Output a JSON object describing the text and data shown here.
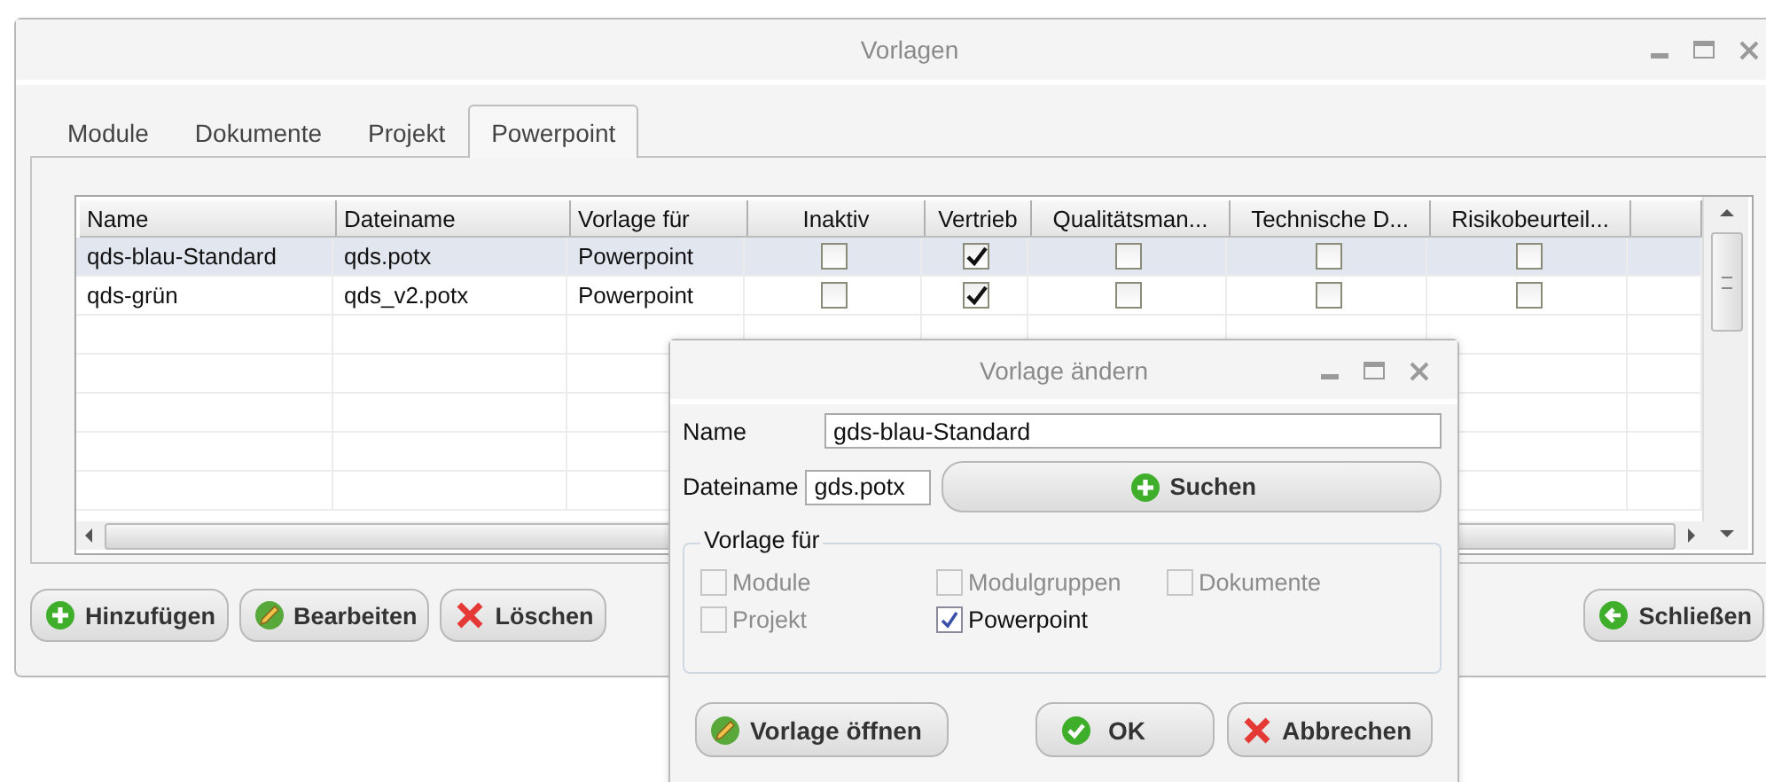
{
  "window": {
    "title": "Vorlagen"
  },
  "tabs": [
    {
      "label": "Module",
      "selected": false
    },
    {
      "label": "Dokumente",
      "selected": false
    },
    {
      "label": "Projekt",
      "selected": false
    },
    {
      "label": "Powerpoint",
      "selected": true
    }
  ],
  "table": {
    "columns": [
      "Name",
      "Dateiname",
      "Vorlage für",
      "Inaktiv",
      "Vertrieb",
      "Qualitätsman...",
      "Technische D...",
      "Risikobeurteil..."
    ],
    "rows": [
      {
        "texts": [
          "qds-blau-Standard",
          "qds.potx",
          "Powerpoint"
        ],
        "checks": [
          false,
          true,
          false,
          false,
          false
        ],
        "selected": true
      },
      {
        "texts": [
          "qds-grün",
          "qds_v2.potx",
          "Powerpoint"
        ],
        "checks": [
          false,
          true,
          false,
          false,
          false
        ],
        "selected": false
      }
    ]
  },
  "buttons": [
    {
      "label": "Hinzufügen",
      "kind": "add"
    },
    {
      "label": "Bearbeiten",
      "kind": "edit"
    },
    {
      "label": "Löschen",
      "kind": "delete"
    }
  ],
  "close_button": {
    "label": "Schließen",
    "kind": "back"
  },
  "dialog": {
    "title": "Vorlage ändern",
    "name_label": "Name",
    "name_value": "gds-blau-Standard",
    "file_label": "Dateiname",
    "file_value": "gds.potx",
    "search_button": {
      "label": "Suchen",
      "kind": "add"
    },
    "group": {
      "title": "Vorlage für",
      "options": [
        {
          "label": "Module",
          "checked": false,
          "disabled": true
        },
        {
          "label": "Modulgruppen",
          "checked": false,
          "disabled": true
        },
        {
          "label": "Dokumente",
          "checked": false,
          "disabled": true
        },
        {
          "label": "Projekt",
          "checked": false,
          "disabled": true
        },
        {
          "label": "Powerpoint",
          "checked": true,
          "disabled": false
        }
      ]
    },
    "buttons": [
      {
        "label": "Vorlage öffnen",
        "kind": "edit"
      },
      {
        "label": "OK",
        "kind": "ok"
      },
      {
        "label": "Abbrechen",
        "kind": "delete"
      }
    ]
  }
}
